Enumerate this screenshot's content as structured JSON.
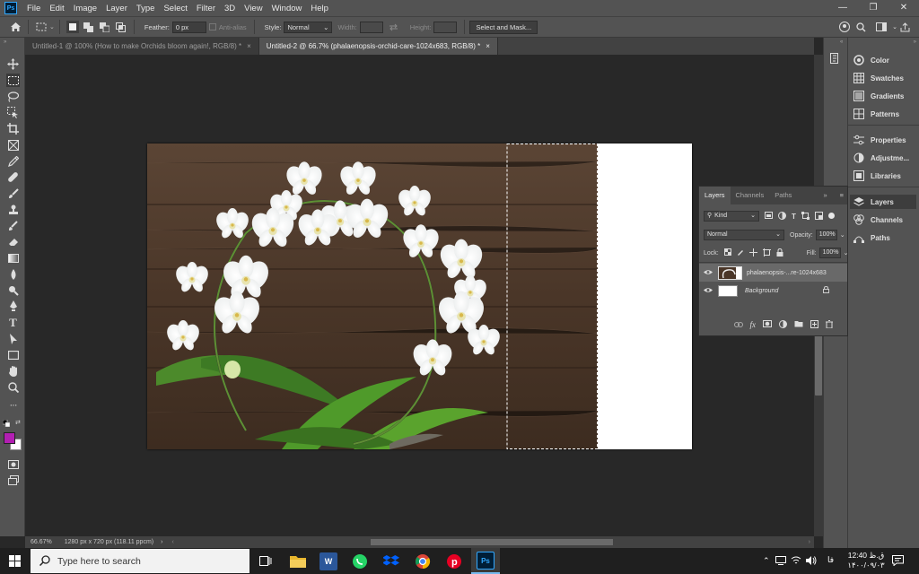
{
  "menubar": {
    "logo": "Ps",
    "items": [
      "File",
      "Edit",
      "Image",
      "Layer",
      "Type",
      "Select",
      "Filter",
      "3D",
      "View",
      "Window",
      "Help"
    ],
    "win_minimize": "—",
    "win_restore": "❐",
    "win_close": "✕"
  },
  "options": {
    "feather_label": "Feather:",
    "feather_value": "0 px",
    "antialias_label": "Anti-alias",
    "style_label": "Style:",
    "style_value": "Normal",
    "width_label": "Width:",
    "height_label": "Height:",
    "select_mask": "Select and Mask..."
  },
  "tabs": [
    {
      "label": "Untitled-1 @ 100% (How to make Orchids bloom again!, RGB/8) *",
      "close": "×"
    },
    {
      "label": "Untitled-2 @ 66.7% (phalaenopsis-orchid-care-1024x683, RGB/8) *",
      "close": "×"
    }
  ],
  "status": {
    "zoom": "66.67%",
    "doc_info": "1280 px x 720 px (118.11 ppcm)",
    "arrow": "›"
  },
  "right_panel": {
    "items": [
      "Color",
      "Swatches",
      "Gradients",
      "Patterns",
      "Properties",
      "Adjustme...",
      "Libraries",
      "Layers",
      "Channels",
      "Paths"
    ]
  },
  "layers_panel": {
    "tabs": [
      "Layers",
      "Channels",
      "Paths"
    ],
    "filter_kind": "Kind",
    "blend_mode": "Normal",
    "opacity_label": "Opacity:",
    "opacity_value": "100%",
    "lock_label": "Lock:",
    "fill_label": "Fill:",
    "fill_value": "100%",
    "layers": [
      {
        "name": "phalaenopsis-...re-1024x683",
        "selected": true
      },
      {
        "name": "Background",
        "selected": false
      }
    ]
  },
  "colors": {
    "foreground": "#b21fb2",
    "background": "#ffffff",
    "accent": "#31a8ff"
  },
  "taskbar": {
    "search_placeholder": "Type here to search",
    "lang": "فا",
    "time": "12:40 ق.ظ",
    "date": "۱۴۰۰/۰۹/۰۳"
  }
}
